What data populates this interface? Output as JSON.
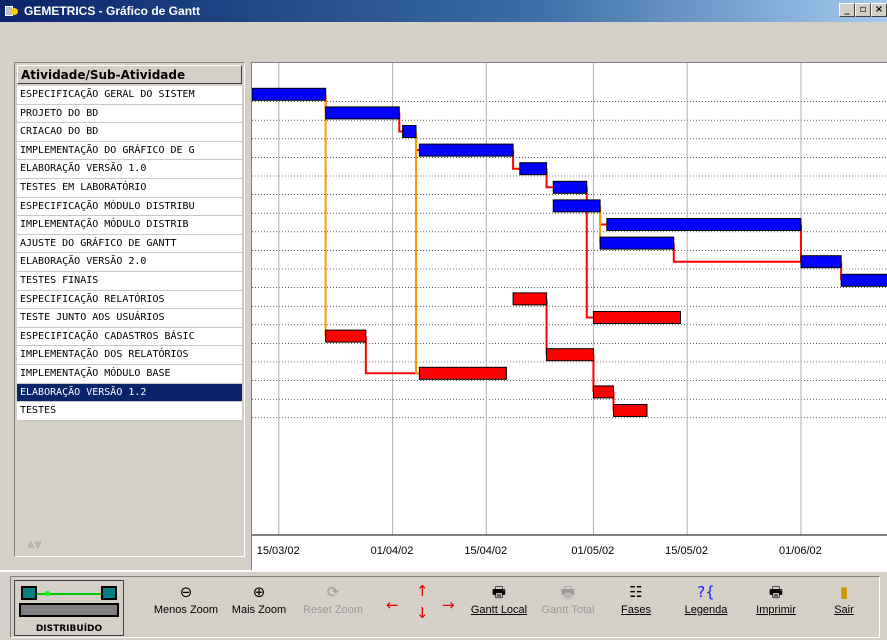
{
  "window": {
    "title": "GEMETRICS - Gráfico de Gantt",
    "buttons": [
      "_",
      "▫",
      "×"
    ]
  },
  "activity_list": {
    "header": "Atividade/Sub-Atividade",
    "rows": [
      "ESPECIFICAÇÃO GERAL DO SISTEM",
      "PROJETO DO BD",
      "CRIACAO DO BD",
      "IMPLEMENTAÇÃO DO GRÁFICO DE G",
      "ELABORAÇÃO VERSÃO 1.0",
      "TESTES EM LABORATÓRIO",
      "ESPECIFICAÇÃO MÓDULO DISTRIBU",
      "IMPLEMENTAÇÃO MÓDULO DISTRIB",
      "AJUSTE DO GRÁFICO DE GANTT",
      "ELABORAÇÃO VERSÃO 2.0",
      "TESTES FINAIS",
      "ESPECIFICAÇÃO RELATÓRIOS",
      "TESTE JUNTO AOS USUÁRIOS",
      "ESPECIFICAÇÃO CADASTROS BÁSIC",
      "IMPLEMENTAÇÃO DOS RELATÓRIOS",
      "IMPLEMENTAÇÃO MÓDULO BASE",
      "ELABORAÇÃO VERSÃO 1.2",
      "TESTES"
    ],
    "selected_index": 16
  },
  "chart_data": {
    "type": "gantt",
    "x_ticks": [
      "15/03/02",
      "01/04/02",
      "15/04/02",
      "01/05/02",
      "15/05/02",
      "01/06/02"
    ],
    "x_tick_days": [
      0,
      17,
      31,
      47,
      61,
      78
    ],
    "x_range_days": [
      -4,
      91
    ],
    "colors": {
      "blue": "#0000ff",
      "red": "#ff0000",
      "grid": "#000000",
      "link_red": "#ff0000",
      "link_orange": "#ff9900"
    },
    "tasks": [
      {
        "row": 0,
        "start": -4,
        "end": 7,
        "color": "blue"
      },
      {
        "row": 1,
        "start": 7,
        "end": 18,
        "color": "blue"
      },
      {
        "row": 2,
        "start": 18.5,
        "end": 20.5,
        "color": "blue"
      },
      {
        "row": 3,
        "start": 21,
        "end": 35,
        "color": "blue"
      },
      {
        "row": 4,
        "start": 36,
        "end": 40,
        "color": "blue"
      },
      {
        "row": 5,
        "start": 41,
        "end": 46,
        "color": "blue"
      },
      {
        "row": 6,
        "start": 41,
        "end": 48,
        "color": "blue"
      },
      {
        "row": 7,
        "start": 49,
        "end": 78,
        "color": "blue"
      },
      {
        "row": 8,
        "start": 48,
        "end": 59,
        "color": "blue"
      },
      {
        "row": 9,
        "start": 78,
        "end": 84,
        "color": "blue"
      },
      {
        "row": 10,
        "start": 84,
        "end": 91,
        "color": "blue"
      },
      {
        "row": 11,
        "start": 35,
        "end": 40,
        "color": "red"
      },
      {
        "row": 12,
        "start": 47,
        "end": 60,
        "color": "red"
      },
      {
        "row": 13,
        "start": 7,
        "end": 13,
        "color": "red"
      },
      {
        "row": 14,
        "start": 40,
        "end": 47,
        "color": "red"
      },
      {
        "row": 15,
        "start": 21,
        "end": 34,
        "color": "red"
      },
      {
        "row": 16,
        "start": 47,
        "end": 50,
        "color": "red"
      },
      {
        "row": 17,
        "start": 50,
        "end": 55,
        "color": "red"
      }
    ],
    "links": [
      {
        "from_row": 0,
        "to_row": 1,
        "color": "link_red"
      },
      {
        "from_row": 1,
        "to_row": 2,
        "color": "link_red"
      },
      {
        "from_row": 2,
        "to_row": 3,
        "color": "link_red"
      },
      {
        "from_row": 3,
        "to_row": 4,
        "color": "link_red"
      },
      {
        "from_row": 4,
        "to_row": 5,
        "color": "link_red"
      },
      {
        "from_row": 5,
        "to_row": 12,
        "color": "link_red"
      },
      {
        "from_row": 6,
        "to_row": 7,
        "color": "link_red"
      },
      {
        "from_row": 6,
        "to_row": 8,
        "color": "link_orange"
      },
      {
        "from_row": 8,
        "to_row": 9,
        "color": "link_red"
      },
      {
        "from_row": 7,
        "to_row": 9,
        "color": "link_red"
      },
      {
        "from_row": 9,
        "to_row": 10,
        "color": "link_red"
      },
      {
        "from_row": 0,
        "to_row": 13,
        "color": "link_orange"
      },
      {
        "from_row": 13,
        "to_row": 15,
        "color": "link_red"
      },
      {
        "from_row": 2,
        "to_row": 15,
        "color": "link_orange"
      },
      {
        "from_row": 11,
        "to_row": 14,
        "color": "link_red"
      },
      {
        "from_row": 14,
        "to_row": 16,
        "color": "link_red"
      },
      {
        "from_row": 16,
        "to_row": 17,
        "color": "link_red"
      }
    ]
  },
  "network_widget": {
    "caption": "DISTRIBUÍDO"
  },
  "toolbar": {
    "menos_zoom": "Menos Zoom",
    "mais_zoom": "Mais Zoom",
    "reset_zoom": "Reset Zoom",
    "gantt_local": "Gantt Local",
    "gantt_total": "Gantt Total",
    "fases": "Fases",
    "legenda": "Legenda",
    "imprimir": "Imprimir",
    "sair": "Sair"
  },
  "icons": {
    "menos_zoom": "zoom-out-icon",
    "mais_zoom": "zoom-in-icon",
    "reset_zoom": "reset-zoom-icon",
    "gantt_local": "printer-local-icon",
    "gantt_total": "printer-total-icon",
    "fases": "phases-icon",
    "legenda": "legend-icon",
    "imprimir": "printer-icon",
    "sair": "exit-door-icon"
  }
}
